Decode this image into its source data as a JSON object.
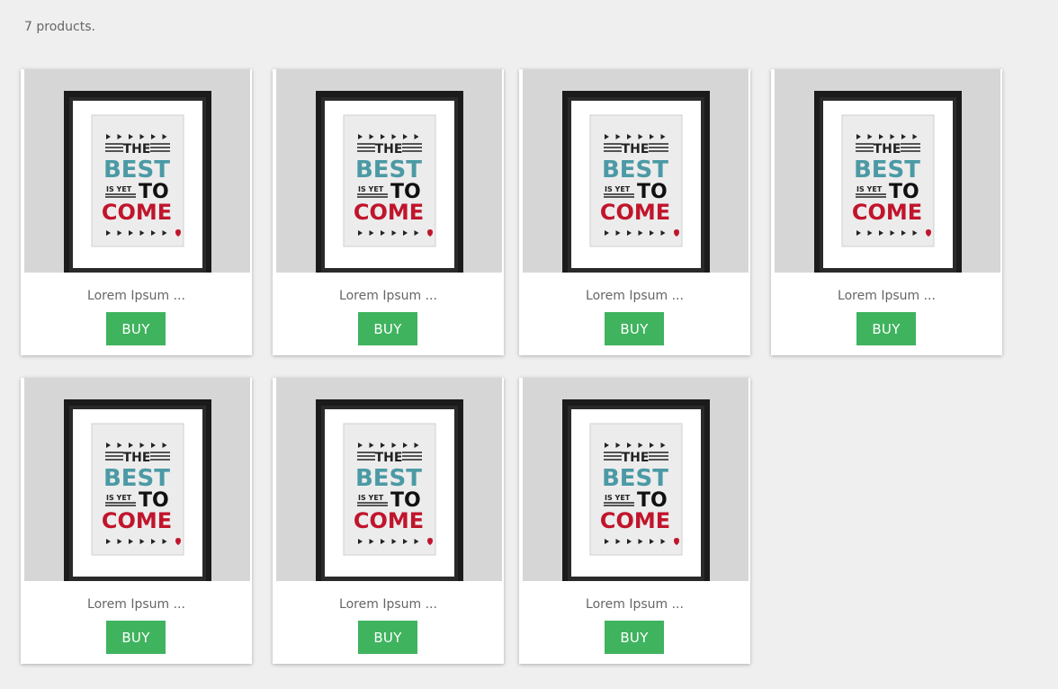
{
  "product_count_text": "7 products.",
  "colors": {
    "buy_button": "#3fb35e",
    "poster_teal": "#4b9aa5",
    "poster_red": "#c0152c"
  },
  "poster": {
    "the": "THE",
    "best": "BEST",
    "is_yet": "IS YET",
    "to": "TO",
    "come": "COME"
  },
  "products": [
    {
      "name": "Lorem Ipsum ...",
      "button": "BUY",
      "image_icon": "framed-poster-image"
    },
    {
      "name": "Lorem Ipsum ...",
      "button": "BUY",
      "image_icon": "framed-poster-image"
    },
    {
      "name": "Lorem Ipsum ...",
      "button": "BUY",
      "image_icon": "framed-poster-image"
    },
    {
      "name": "Lorem Ipsum ...",
      "button": "BUY",
      "image_icon": "framed-poster-image"
    },
    {
      "name": "Lorem Ipsum ...",
      "button": "BUY",
      "image_icon": "framed-poster-image"
    },
    {
      "name": "Lorem Ipsum ...",
      "button": "BUY",
      "image_icon": "framed-poster-image"
    },
    {
      "name": "Lorem Ipsum ...",
      "button": "BUY",
      "image_icon": "framed-poster-image"
    }
  ]
}
